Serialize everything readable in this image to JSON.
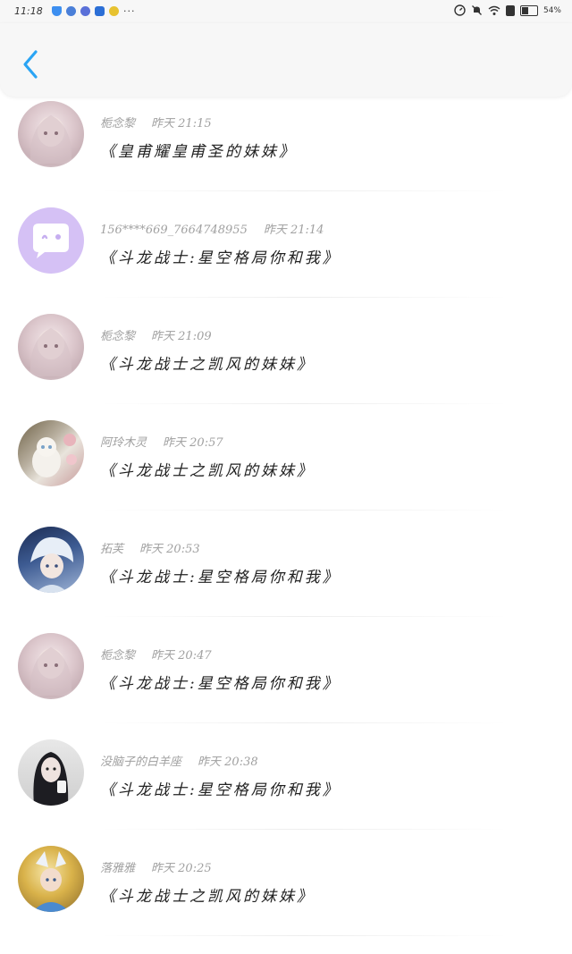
{
  "status": {
    "time": "11:18",
    "dots": "···",
    "battery_text": "54%"
  },
  "header": {
    "back_icon": "chevron-left-icon",
    "accent": "#2aa4f4"
  },
  "items": [
    {
      "name": "栀念黎",
      "time": "昨天 21:15",
      "text": "《皇甫耀皇甫圣的妹妹》",
      "avatar": "pink-anime-girl"
    },
    {
      "name": "156****669_7664748955",
      "time": "昨天 21:14",
      "text": "《斗龙战士:星空格局你和我》",
      "avatar": "default-chat-bubble"
    },
    {
      "name": "栀念黎",
      "time": "昨天 21:09",
      "text": "《斗龙战士之凯风的妹妹》",
      "avatar": "pink-anime-girl"
    },
    {
      "name": "阿玲木灵",
      "time": "昨天 20:57",
      "text": "《斗龙战士之凯风的妹妹》",
      "avatar": "white-cat-flowers"
    },
    {
      "name": "拓芙",
      "time": "昨天 20:53",
      "text": "《斗龙战士:星空格局你和我》",
      "avatar": "white-hair-anime-boy"
    },
    {
      "name": "栀念黎",
      "time": "昨天 20:47",
      "text": "《斗龙战士:星空格局你和我》",
      "avatar": "pink-anime-girl"
    },
    {
      "name": "没脑子的白羊座",
      "time": "昨天 20:38",
      "text": "《斗龙战士:星空格局你和我》",
      "avatar": "dark-hair-girl-photo"
    },
    {
      "name": "落雅雅",
      "time": "昨天 20:25",
      "text": "《斗龙战士之凯风的妹妹》",
      "avatar": "game-character-gold"
    }
  ]
}
